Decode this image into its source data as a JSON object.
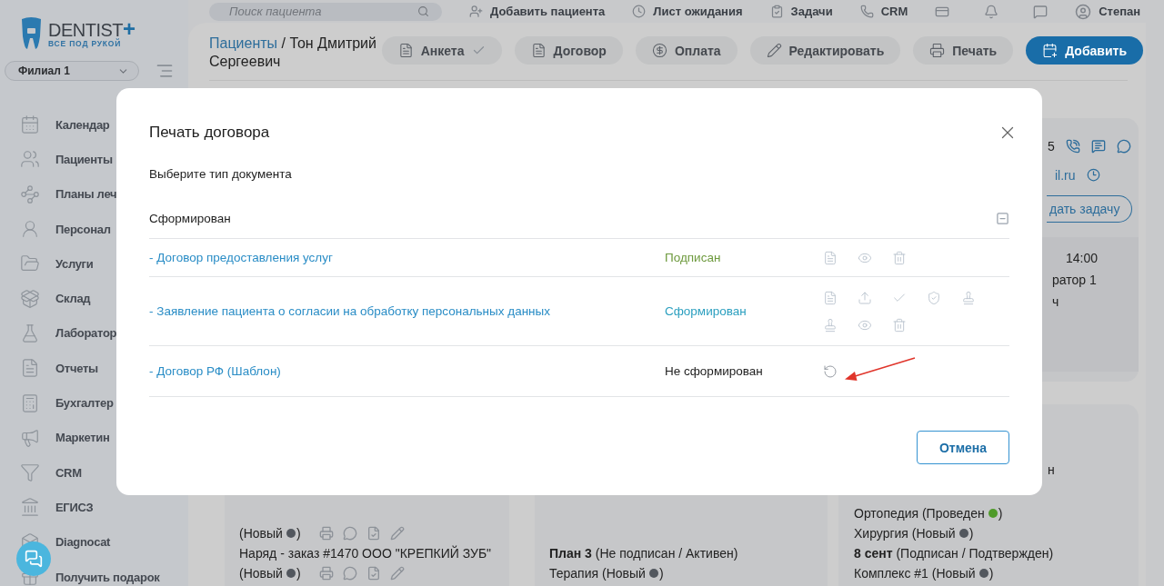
{
  "top_bar": {
    "search": {
      "placeholder": "Поиск пациента"
    },
    "items": [
      {
        "label": "Добавить пациента"
      },
      {
        "label": "Лист ожидания"
      },
      {
        "label": "Задачи"
      },
      {
        "label": "CRM"
      }
    ],
    "user": {
      "name": "Степан"
    }
  },
  "sidebar": {
    "brand": {
      "name": "DENTIST",
      "mark": "+",
      "tagline": "ВСЕ ПОД РУКОЙ"
    },
    "branch_select": {
      "value": "Филиал 1"
    },
    "items": [
      {
        "label": "Календар"
      },
      {
        "label": "Пациенты"
      },
      {
        "label": "Планы леч"
      },
      {
        "label": "Персонал"
      },
      {
        "label": "Услуги"
      },
      {
        "label": "Склад"
      },
      {
        "label": "Лаборатор"
      },
      {
        "label": "Отчеты"
      },
      {
        "label": "Бухгалтер"
      },
      {
        "label": "Маркетин"
      },
      {
        "label": "CRM"
      },
      {
        "label": "ЕГИСЗ"
      },
      {
        "label": "Diagnocat"
      },
      {
        "label": "Получить подарок"
      }
    ]
  },
  "header": {
    "breadcrumb": {
      "parent": "Пациенты",
      "current": "/ Тон Дмитрий Сергеевич"
    },
    "buttons": [
      {
        "label": "Анкета",
        "done": true,
        "primary": false
      },
      {
        "label": "Договор",
        "done": false,
        "primary": false
      },
      {
        "label": "Оплата",
        "done": false,
        "primary": false
      },
      {
        "label": "Редактировать",
        "done": false,
        "primary": false
      },
      {
        "label": "Печать",
        "done": false,
        "primary": false
      },
      {
        "label": "Добавить",
        "done": false,
        "primary": true
      }
    ]
  },
  "contact": {
    "phone_tail": "5",
    "email_tail": "il.ru",
    "task_button": "дать задачу"
  },
  "visit_card": {
    "lines": [
      "14:00",
      "ратор 1",
      "ч"
    ]
  },
  "left_card": {
    "lines": [
      {
        "kind": "status",
        "before": "(Новый",
        "after": ")",
        "color": "#52575e",
        "actions": true
      },
      {
        "kind": "text",
        "text": "Наряд - заказ #1470 ООО \"КРЕПКИЙ ЗУБ\""
      },
      {
        "kind": "status",
        "before": "(Новый",
        "after": ")",
        "color": "#52575e",
        "actions": true
      }
    ]
  },
  "plans_card": {
    "lines": [
      {
        "kind": "text",
        "text": "**План 3** (Не подписан / Активен)"
      },
      {
        "kind": "status",
        "before": "Терапия (Новый",
        "after": ")",
        "color": "#52575e"
      }
    ]
  },
  "right_card": {
    "fragment": "н",
    "lines": [
      {
        "kind": "status",
        "before": "Ортопедия (Проведен",
        "after": ")",
        "color": "#4f9a2a"
      },
      {
        "kind": "status",
        "before": "Хирургия (Новый",
        "after": ")",
        "color": "#52575e"
      },
      {
        "kind": "text",
        "text": "**8 сент** (Подписан / Подтвержден)"
      },
      {
        "kind": "status",
        "before": "Комплекс #1 (Новый",
        "after": ")",
        "color": "#52575e"
      }
    ]
  },
  "modal": {
    "title": "Печать договора",
    "prompt": "Выберите тип документа",
    "group": {
      "label": "Сформирован",
      "expanded": true
    },
    "documents": [
      {
        "name": "- Договор предоставления услуг",
        "status": "Подписан",
        "kind": "signed",
        "actions": [
          {
            "kind": "pdf"
          },
          {
            "kind": "view"
          },
          {
            "kind": "delete"
          }
        ]
      },
      {
        "name": "- Заявление пациента о согласии на обработку персональных данных",
        "status": "Сформирован",
        "kind": "formed",
        "actions": [
          {
            "kind": "pdf"
          },
          {
            "kind": "upload"
          },
          {
            "kind": "check"
          },
          {
            "kind": "shield"
          },
          {
            "kind": "stamp"
          },
          {
            "kind": "stamp"
          },
          {
            "kind": "view"
          },
          {
            "kind": "delete"
          }
        ]
      },
      {
        "name": "- Договор РФ (Шаблон)",
        "status": "Не сформирован",
        "kind": "not_formed",
        "actions": [
          {
            "kind": "refresh"
          }
        ]
      }
    ],
    "cancel_button": "Отмена"
  }
}
